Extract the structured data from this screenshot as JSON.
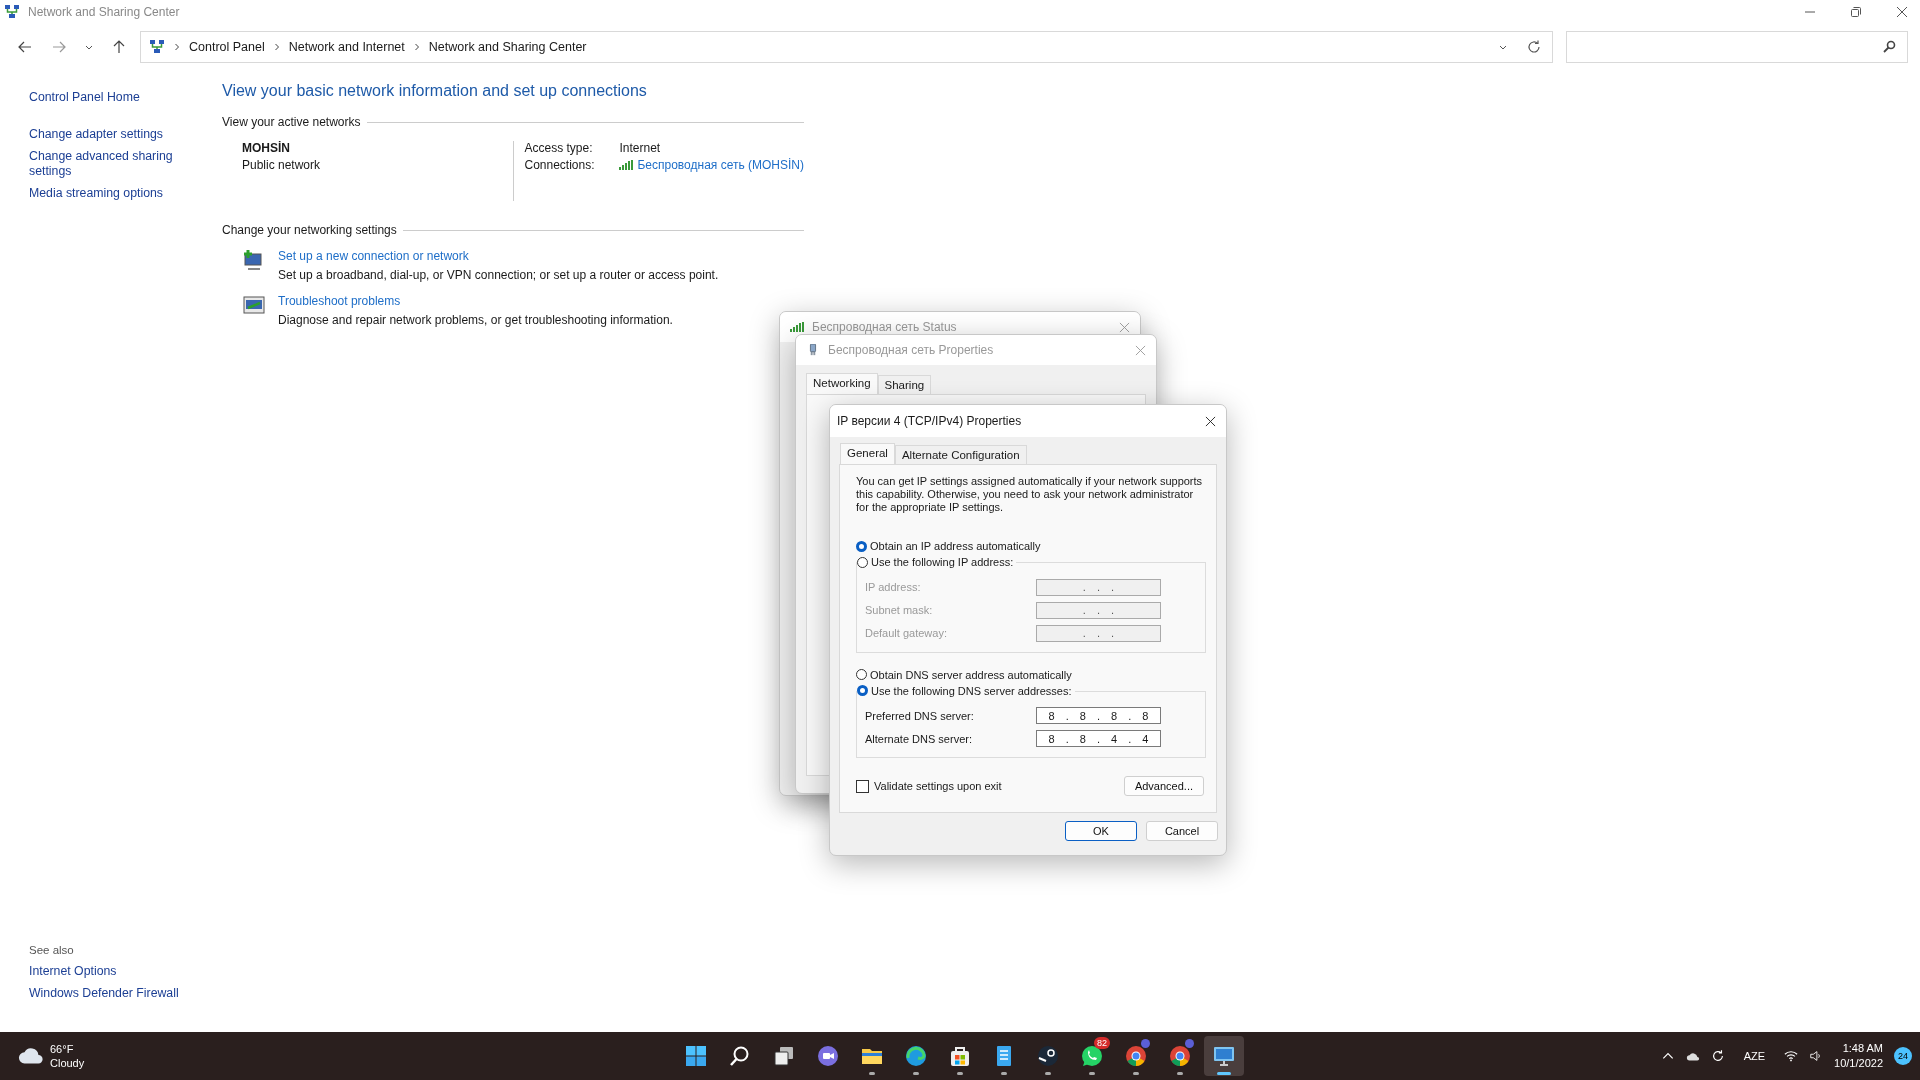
{
  "window": {
    "title": "Network and Sharing Center"
  },
  "address_bar": {
    "breadcrumbs": [
      "Control Panel",
      "Network and Internet",
      "Network and Sharing Center"
    ]
  },
  "sidebar": {
    "links": [
      "Control Panel Home",
      "Change adapter settings",
      "Change advanced sharing settings",
      "Media streaming options"
    ],
    "see_also": {
      "title": "See also",
      "links": [
        "Internet Options",
        "Windows Defender Firewall"
      ]
    }
  },
  "main": {
    "heading": "View your basic network information and set up connections",
    "active_networks": {
      "section_title": "View your active networks",
      "network_name": "MOHSİN",
      "network_type": "Public network",
      "access_type_label": "Access type:",
      "access_type_value": "Internet",
      "connections_label": "Connections:",
      "connection_link": "Беспроводная сеть (MOHSİN)"
    },
    "change_settings": {
      "section_title": "Change your networking settings",
      "items": [
        {
          "kind": "setup",
          "link": "Set up a new connection or network",
          "description": "Set up a broadband, dial-up, or VPN connection; or set up a router or access point."
        },
        {
          "kind": "troubleshoot",
          "link": "Troubleshoot problems",
          "description": "Diagnose and repair network problems, or get troubleshooting information."
        }
      ]
    }
  },
  "status_window": {
    "title": "Беспроводная сеть Status"
  },
  "properties_window": {
    "title": "Беспроводная сеть Properties",
    "tabs": [
      {
        "label": "Networking",
        "selected": true
      },
      {
        "label": "Sharing",
        "selected": false
      }
    ]
  },
  "ipv4_dialog": {
    "title": "IP версии 4 (TCP/IPv4) Properties",
    "tabs": [
      {
        "label": "General",
        "selected": true
      },
      {
        "label": "Alternate Configuration",
        "selected": false
      }
    ],
    "intro": "You can get IP settings assigned automatically if your network supports this capability. Otherwise, you need to ask your network administrator for the appropriate IP settings.",
    "ip_mode": [
      {
        "label": "Obtain an IP address automatically",
        "selected": true
      },
      {
        "label": "Use the following IP address:",
        "selected": false
      }
    ],
    "ip_fields": [
      {
        "label": "IP address:",
        "text": ". . .",
        "disabled": true
      },
      {
        "label": "Subnet mask:",
        "text": ". . .",
        "disabled": true
      },
      {
        "label": "Default gateway:",
        "text": ". . .",
        "disabled": true
      }
    ],
    "dns_mode": [
      {
        "label": "Obtain DNS server address automatically",
        "selected": false
      },
      {
        "label": "Use the following DNS server addresses:",
        "selected": true
      }
    ],
    "dns_fields": [
      {
        "label": "Preferred DNS server:",
        "text": "8 . 8 . 8 . 8",
        "disabled": false
      },
      {
        "label": "Alternate DNS server:",
        "text": "8 . 8 . 4 . 4",
        "disabled": false
      }
    ],
    "validate": {
      "label": "Validate settings upon exit",
      "checked": false
    },
    "advanced_button": "Advanced...",
    "ok_button": "OK",
    "cancel_button": "Cancel"
  },
  "taskbar": {
    "weather": {
      "temperature": "66°F",
      "condition": "Cloudy"
    },
    "apps": [
      {
        "kind": "start",
        "running": false,
        "active": false
      },
      {
        "kind": "search",
        "running": false,
        "active": false
      },
      {
        "kind": "taskview",
        "running": false,
        "active": false
      },
      {
        "kind": "chat",
        "running": false,
        "active": false
      },
      {
        "kind": "files",
        "running": true,
        "active": false
      },
      {
        "kind": "edge",
        "running": true,
        "active": false
      },
      {
        "kind": "store",
        "running": true,
        "active": false
      },
      {
        "kind": "notepad",
        "running": true,
        "active": false
      },
      {
        "kind": "steam",
        "running": true,
        "active": false
      },
      {
        "kind": "whatsapp",
        "running": true,
        "active": false,
        "badge": "82"
      },
      {
        "kind": "chrome",
        "running": true,
        "active": false,
        "alert": true
      },
      {
        "kind": "chrome",
        "running": true,
        "active": false,
        "alert": true
      },
      {
        "kind": "remote",
        "running": true,
        "active": true
      }
    ],
    "language": "AZE",
    "time": "1:48 AM",
    "date": "10/1/2022",
    "notifications": "24"
  }
}
